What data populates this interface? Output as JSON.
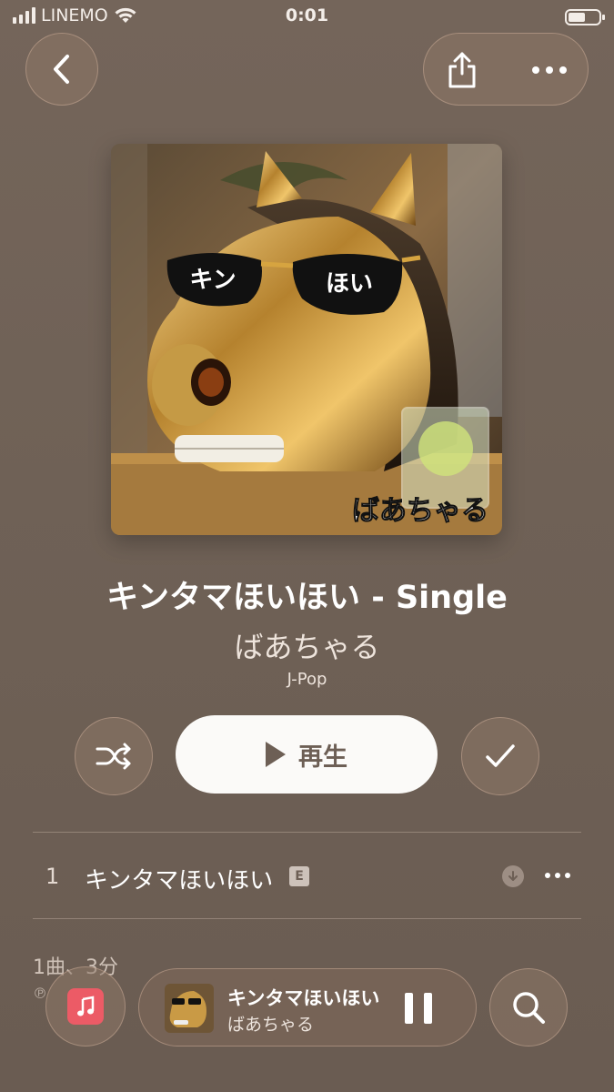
{
  "status_bar": {
    "carrier": "LINEMO",
    "time": "0:01"
  },
  "nav": {
    "back_icon": "chevron-left-icon",
    "share_icon": "share-icon",
    "more_icon": "ellipsis-icon"
  },
  "album": {
    "title": "キンタマほいほい - Single",
    "artist": "ばあちゃる",
    "genre": "J-Pop",
    "art_text_left": "キン",
    "art_text_right": "ほい",
    "art_text_artist": "ばあちゃる"
  },
  "actions": {
    "shuffle_icon": "shuffle-icon",
    "play_label": "再生",
    "added_icon": "checkmark-icon"
  },
  "tracks": [
    {
      "number": "1",
      "title": "キンタマほいほい",
      "explicit_badge": "E"
    }
  ],
  "footer": {
    "summary": "1曲、3分",
    "copyright": "℗"
  },
  "mini_player": {
    "title": "キンタマほいほい",
    "artist": "ばあちゃる"
  },
  "colors": {
    "background": "#6f6156",
    "library_icon": "#ec5b66",
    "play_button_bg": "#fbfaf8"
  }
}
